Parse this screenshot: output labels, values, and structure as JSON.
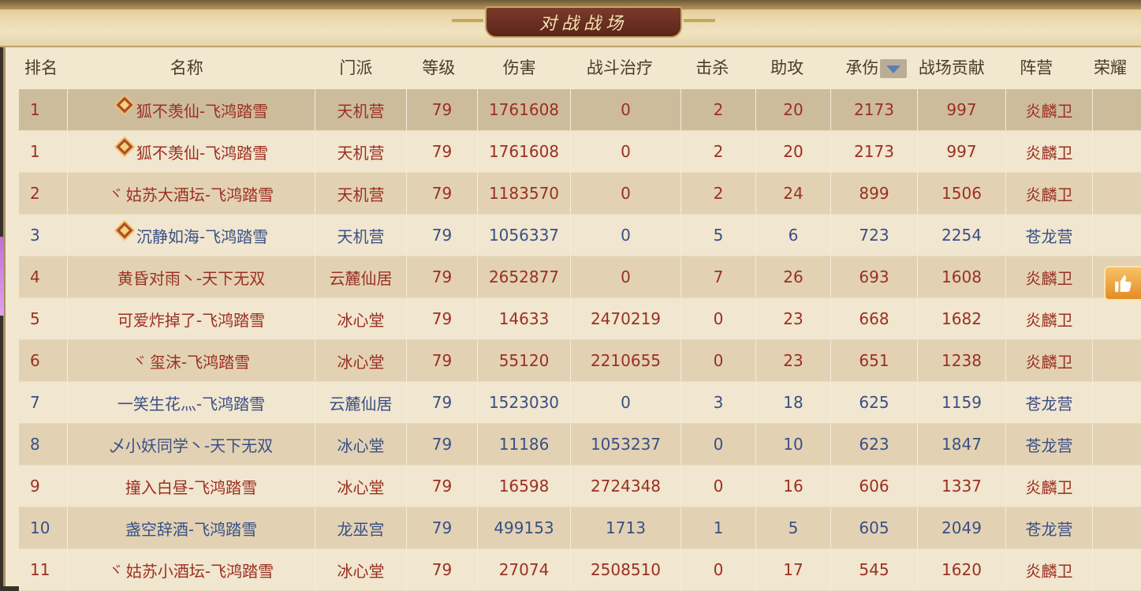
{
  "window": {
    "title": "对战战场"
  },
  "columns": [
    "排名",
    "名称",
    "门派",
    "等级",
    "伤害",
    "战斗治疗",
    "击杀",
    "助攻",
    "承伤",
    "战场贡献",
    "阵营",
    "荣耀"
  ],
  "colors": {
    "red_text": "#9b2f22",
    "blue_text": "#3a4f86",
    "accent_orange": "#e38d25"
  },
  "rows": [
    {
      "rank": "1",
      "prefix": "badge",
      "name": "狐不羡仙-飞鸿踏雪",
      "sect": "天机营",
      "level": "79",
      "damage": "1761608",
      "healing": "0",
      "kills": "2",
      "assists": "20",
      "taken": "2173",
      "contribution": "997",
      "camp": "炎麟卫",
      "color": "red"
    },
    {
      "rank": "1",
      "prefix": "badge",
      "name": "狐不羡仙-飞鸿踏雪",
      "sect": "天机营",
      "level": "79",
      "damage": "1761608",
      "healing": "0",
      "kills": "2",
      "assists": "20",
      "taken": "2173",
      "contribution": "997",
      "camp": "炎麟卫",
      "color": "red"
    },
    {
      "rank": "2",
      "prefix": "v",
      "name": "姑苏大酒坛-飞鸿踏雪",
      "sect": "天机营",
      "level": "79",
      "damage": "1183570",
      "healing": "0",
      "kills": "2",
      "assists": "24",
      "taken": "899",
      "contribution": "1506",
      "camp": "炎麟卫",
      "color": "red"
    },
    {
      "rank": "3",
      "prefix": "badge",
      "name": "沉静如海-飞鸿踏雪",
      "sect": "天机营",
      "level": "79",
      "damage": "1056337",
      "healing": "0",
      "kills": "5",
      "assists": "6",
      "taken": "723",
      "contribution": "2254",
      "camp": "苍龙营",
      "color": "blue"
    },
    {
      "rank": "4",
      "prefix": "",
      "name": "黄昏对雨丶-天下无双",
      "sect": "云麓仙居",
      "level": "79",
      "damage": "2652877",
      "healing": "0",
      "kills": "7",
      "assists": "26",
      "taken": "693",
      "contribution": "1608",
      "camp": "炎麟卫",
      "color": "red"
    },
    {
      "rank": "5",
      "prefix": "",
      "name": "可爱炸掉了-飞鸿踏雪",
      "sect": "冰心堂",
      "level": "79",
      "damage": "14633",
      "healing": "2470219",
      "kills": "0",
      "assists": "23",
      "taken": "668",
      "contribution": "1682",
      "camp": "炎麟卫",
      "color": "red"
    },
    {
      "rank": "6",
      "prefix": "v",
      "name": "玺沫-飞鸿踏雪",
      "sect": "冰心堂",
      "level": "79",
      "damage": "55120",
      "healing": "2210655",
      "kills": "0",
      "assists": "23",
      "taken": "651",
      "contribution": "1238",
      "camp": "炎麟卫",
      "color": "red"
    },
    {
      "rank": "7",
      "prefix": "",
      "name": "一笑生花灬-飞鸿踏雪",
      "sect": "云麓仙居",
      "level": "79",
      "damage": "1523030",
      "healing": "0",
      "kills": "3",
      "assists": "18",
      "taken": "625",
      "contribution": "1159",
      "camp": "苍龙营",
      "color": "blue"
    },
    {
      "rank": "8",
      "prefix": "",
      "name": "乄小妖同学丶-天下无双",
      "sect": "冰心堂",
      "level": "79",
      "damage": "11186",
      "healing": "1053237",
      "kills": "0",
      "assists": "10",
      "taken": "623",
      "contribution": "1847",
      "camp": "苍龙营",
      "color": "blue"
    },
    {
      "rank": "9",
      "prefix": "",
      "name": "撞入白昼-飞鸿踏雪",
      "sect": "冰心堂",
      "level": "79",
      "damage": "16598",
      "healing": "2724348",
      "kills": "0",
      "assists": "16",
      "taken": "606",
      "contribution": "1337",
      "camp": "炎麟卫",
      "color": "red"
    },
    {
      "rank": "10",
      "prefix": "",
      "name": "盏空辞酒-飞鸿踏雪",
      "sect": "龙巫宫",
      "level": "79",
      "damage": "499153",
      "healing": "1713",
      "kills": "1",
      "assists": "5",
      "taken": "605",
      "contribution": "2049",
      "camp": "苍龙营",
      "color": "blue"
    },
    {
      "rank": "11",
      "prefix": "v",
      "name": "姑苏小酒坛-飞鸿踏雪",
      "sect": "冰心堂",
      "level": "79",
      "damage": "27074",
      "healing": "2508510",
      "kills": "0",
      "assists": "17",
      "taken": "545",
      "contribution": "1620",
      "camp": "炎麟卫",
      "color": "red"
    }
  ]
}
